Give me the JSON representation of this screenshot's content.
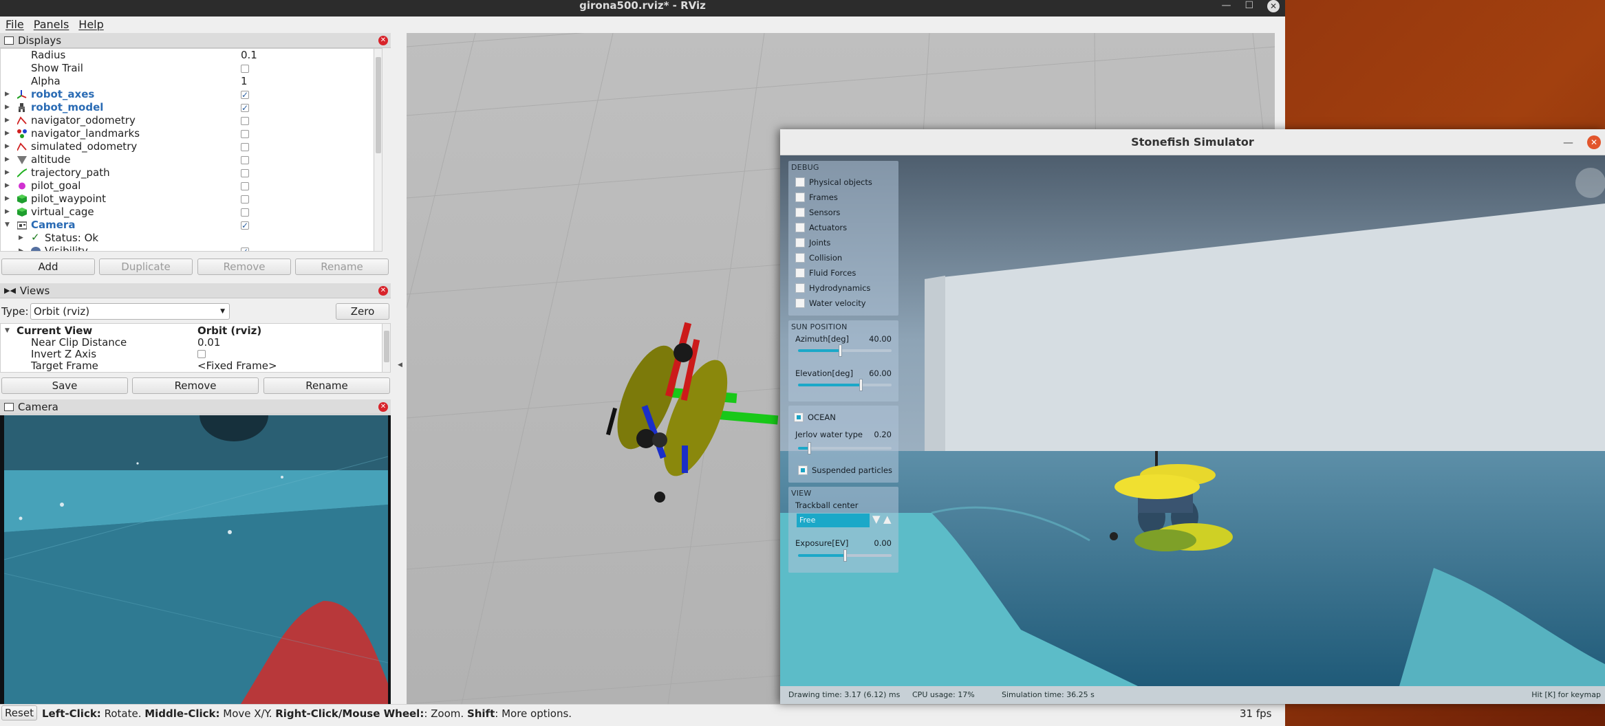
{
  "rviz": {
    "title": "girona500.rviz* - RViz",
    "menu": [
      "File",
      "Panels",
      "Help"
    ],
    "displays_panel": {
      "title": "Displays",
      "rows": [
        {
          "label": "Radius",
          "value": "0.1",
          "indent": true
        },
        {
          "label": "Show Trail",
          "checkbox": false,
          "indent": true
        },
        {
          "label": "Alpha",
          "value": "1",
          "indent": true
        },
        {
          "label": "robot_axes",
          "checkbox": true,
          "bold": true,
          "icon": "axes-icon"
        },
        {
          "label": "robot_model",
          "checkbox": true,
          "bold": true,
          "icon": "robot-model-icon"
        },
        {
          "label": "navigator_odometry",
          "checkbox": false,
          "icon": "odometry-icon"
        },
        {
          "label": "navigator_landmarks",
          "checkbox": false,
          "icon": "landmarks-icon"
        },
        {
          "label": "simulated_odometry",
          "checkbox": false,
          "icon": "odometry-icon"
        },
        {
          "label": "altitude",
          "checkbox": false,
          "icon": "range-icon"
        },
        {
          "label": "trajectory_path",
          "checkbox": false,
          "icon": "path-icon"
        },
        {
          "label": "pilot_goal",
          "checkbox": false,
          "icon": "pose-icon"
        },
        {
          "label": "pilot_waypoint",
          "checkbox": false,
          "icon": "marker-icon"
        },
        {
          "label": "virtual_cage",
          "checkbox": false,
          "icon": "marker-icon"
        },
        {
          "label": "Camera",
          "checkbox": true,
          "bold": true,
          "icon": "camera-icon",
          "expanded": true
        },
        {
          "label": "Status: Ok",
          "icon": "status-ok-icon",
          "sub": true
        },
        {
          "label": "Visibility",
          "checkbox": true,
          "icon": "visibility-icon",
          "sub": true
        }
      ],
      "buttons": [
        "Add",
        "Duplicate",
        "Remove",
        "Rename"
      ]
    },
    "views_panel": {
      "title": "Views",
      "type_label": "Type:",
      "type_value": "Orbit (rviz)",
      "zero_label": "Zero",
      "rows": [
        {
          "label": "Current View",
          "value": "Orbit (rviz)",
          "bold": true
        },
        {
          "label": "Near Clip Distance",
          "value": "0.01"
        },
        {
          "label": "Invert Z Axis",
          "checkbox": false
        },
        {
          "label": "Target Frame",
          "value": "<Fixed Frame>"
        }
      ],
      "buttons": [
        "Save",
        "Remove",
        "Rename"
      ]
    },
    "camera_panel": {
      "title": "Camera"
    },
    "status": {
      "reset": "Reset",
      "left": "Left-Click:",
      "left_desc": " Rotate. ",
      "middle": "Middle-Click:",
      "middle_desc": " Move X/Y. ",
      "right": "Right-Click/Mouse Wheel:",
      "right_desc": ": Zoom. ",
      "shift": "Shift",
      "shift_desc": ": More options.",
      "fps": "31 fps"
    }
  },
  "stonefish": {
    "title": "Stonefish Simulator",
    "debug": {
      "header": "DEBUG",
      "items": [
        "Physical objects",
        "Frames",
        "Sensors",
        "Actuators",
        "Joints",
        "Collision",
        "Fluid Forces",
        "Hydrodynamics",
        "Water velocity"
      ]
    },
    "sun": {
      "header": "SUN POSITION",
      "azimuth_label": "Azimuth[deg]",
      "azimuth_value": "40.00",
      "azimuth_frac": 0.45,
      "elevation_label": "Elevation[deg]",
      "elevation_value": "60.00",
      "elevation_frac": 0.67
    },
    "ocean": {
      "label": "OCEAN",
      "enabled": true,
      "jerlov_label": "Jerlov water type",
      "jerlov_value": "0.20",
      "jerlov_frac": 0.12,
      "particles_label": "Suspended particles",
      "particles_enabled": true
    },
    "view": {
      "header": "VIEW",
      "trackball_label": "Trackball center",
      "trackball_value": "Free",
      "exposure_label": "Exposure[EV]",
      "exposure_value": "0.00",
      "exposure_frac": 0.5
    },
    "status": {
      "drawing": "Drawing time: 3.17 (6.12) ms",
      "cpu": "CPU usage: 17%",
      "sim": "Simulation time: 36.25 s",
      "keymap": "Hit [K] for keymap"
    },
    "colors": {
      "accent": "#1ba8c8",
      "ocean": "#3e8aa6",
      "hull_yellow": "#e2d22a"
    }
  }
}
